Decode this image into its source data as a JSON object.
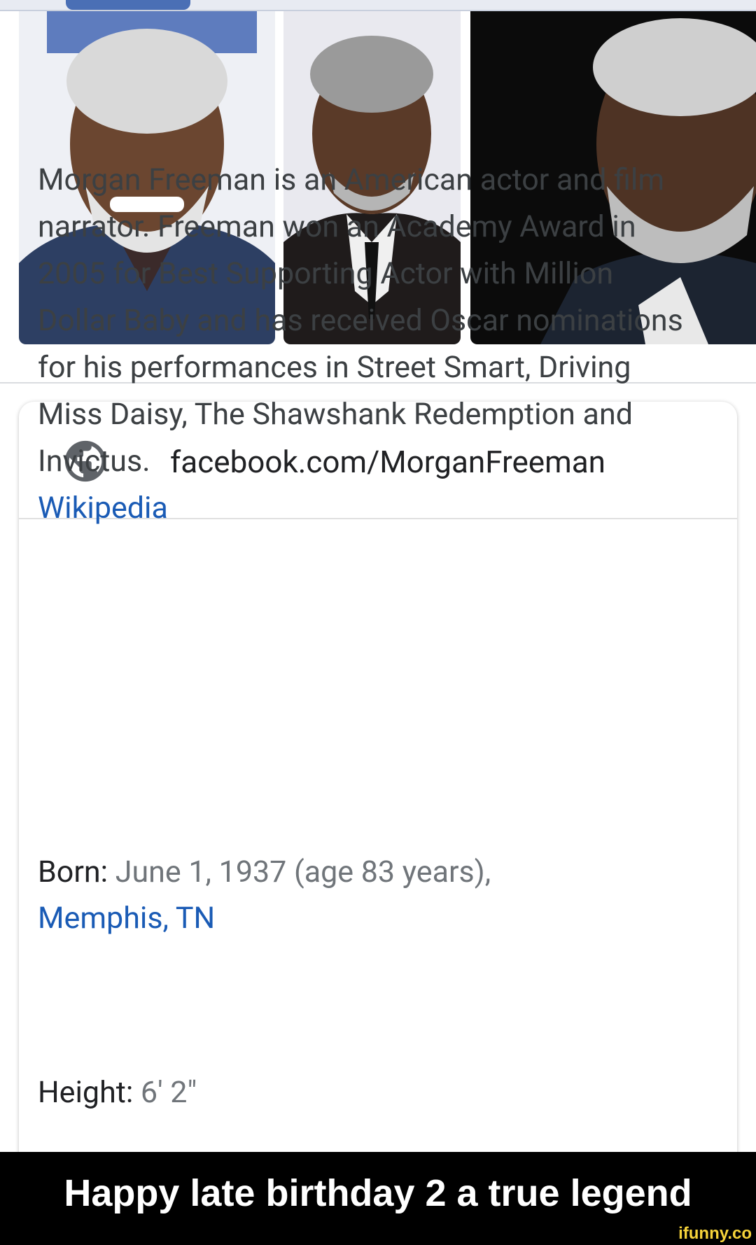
{
  "link": {
    "url_text": "facebook.com/MorganFreeman"
  },
  "description": {
    "text": "Morgan Freeman is an American actor and film narrator. Freeman won an Academy Award in 2005 for Best Supporting Actor with Million Dollar Baby and has received Oscar nominations for his performances in Street Smart, Driving Miss Daisy, The Shawshank Redemption and Invictus.",
    "source": "Wikipedia"
  },
  "facts": {
    "born_label": "Born:",
    "born_value": "June 1, 1937 (age 83 years),",
    "born_place": "Memphis, TN",
    "height_label": "Height:",
    "height_value": "6' 2\""
  },
  "caption": "Happy late birthday 2 a true legend",
  "watermark": "ifunny.co"
}
